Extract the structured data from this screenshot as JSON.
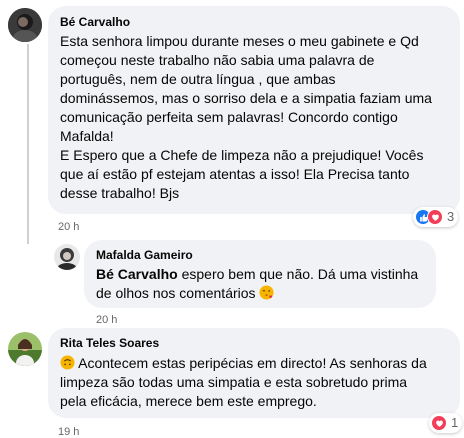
{
  "comments": [
    {
      "author": "Bé Carvalho",
      "lines": [
        "Esta senhora limpou durante meses o meu gabinete e Qd",
        "começou neste trabalho não sabia uma palavra de",
        "português, nem de outra língua , que ambas",
        "dominássemos, mas o sorriso dela e a simpatia faziam uma",
        "comunicação perfeita sem palavras! Concordo contigo",
        "Mafalda!",
        "E Espero que a Chefe de limpeza não a prejudique! Vocês",
        "que aí estão pf estejam atentas a isso! Ela Precisa tanto",
        "desse trabalho! Bjs"
      ],
      "time": "20 h",
      "reaction_count": "3",
      "reactions": [
        "like-icon",
        "love-icon"
      ]
    },
    {
      "author": "Mafalda Gameiro",
      "mention": "Bé Carvalho",
      "line1_rest": " espero bem que não. Dá uma vistinha",
      "line2": "de olhos nos comentários",
      "emoji": "face-blowing-kiss-icon",
      "time": "20 h"
    },
    {
      "author": "Rita Teles Soares",
      "emoji": "upside-down-face-icon",
      "line1": " Acontecem estas peripécias em directo! As senhoras da",
      "line2": "limpeza são todas uma simpatia e esta sobretudo prima",
      "line3": "pela eficácia, merece bem este emprego.",
      "time": "19 h",
      "reaction_count": "1",
      "reactions": [
        "love-icon"
      ]
    }
  ],
  "colors": {
    "bubble": "#f0f2f5",
    "meta": "#65676b",
    "like": "#1877f2",
    "love": "#f33e58"
  }
}
